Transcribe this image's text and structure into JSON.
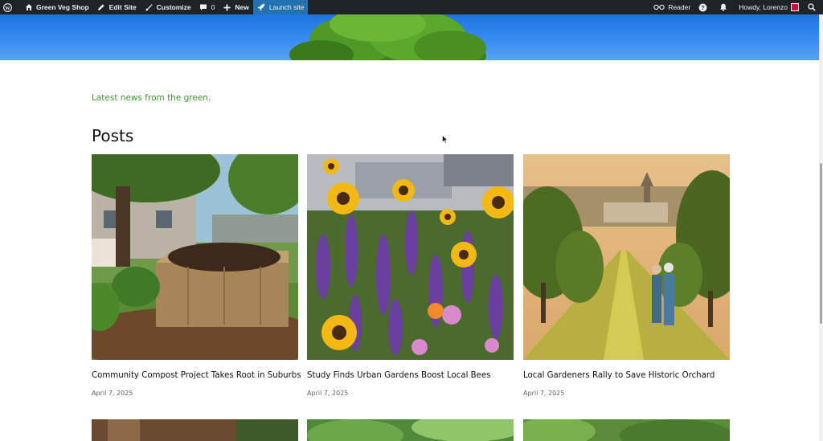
{
  "adminbar": {
    "site_name": "Green Veg Shop",
    "edit_site": "Edit Site",
    "customize": "Customize",
    "comments_count": "0",
    "new_label": "New",
    "launch_label": "Launch site",
    "reader_label": "Reader",
    "howdy": "Howdy, Lorenzo"
  },
  "page": {
    "tagline": "Latest news from the green.",
    "section_title": "Posts"
  },
  "posts": [
    {
      "title": "Community Compost Project Takes Root in Suburbs",
      "date": "April 7, 2025"
    },
    {
      "title": "Study Finds Urban Gardens Boost Local Bees",
      "date": "April 7, 2025"
    },
    {
      "title": "Local Gardeners Rally to Save Historic Orchard",
      "date": "April 7, 2025"
    }
  ],
  "colors": {
    "adminbar_bg": "#1d2327",
    "launch_bg": "#2271b1",
    "tagline_green": "#3f9a2e"
  }
}
